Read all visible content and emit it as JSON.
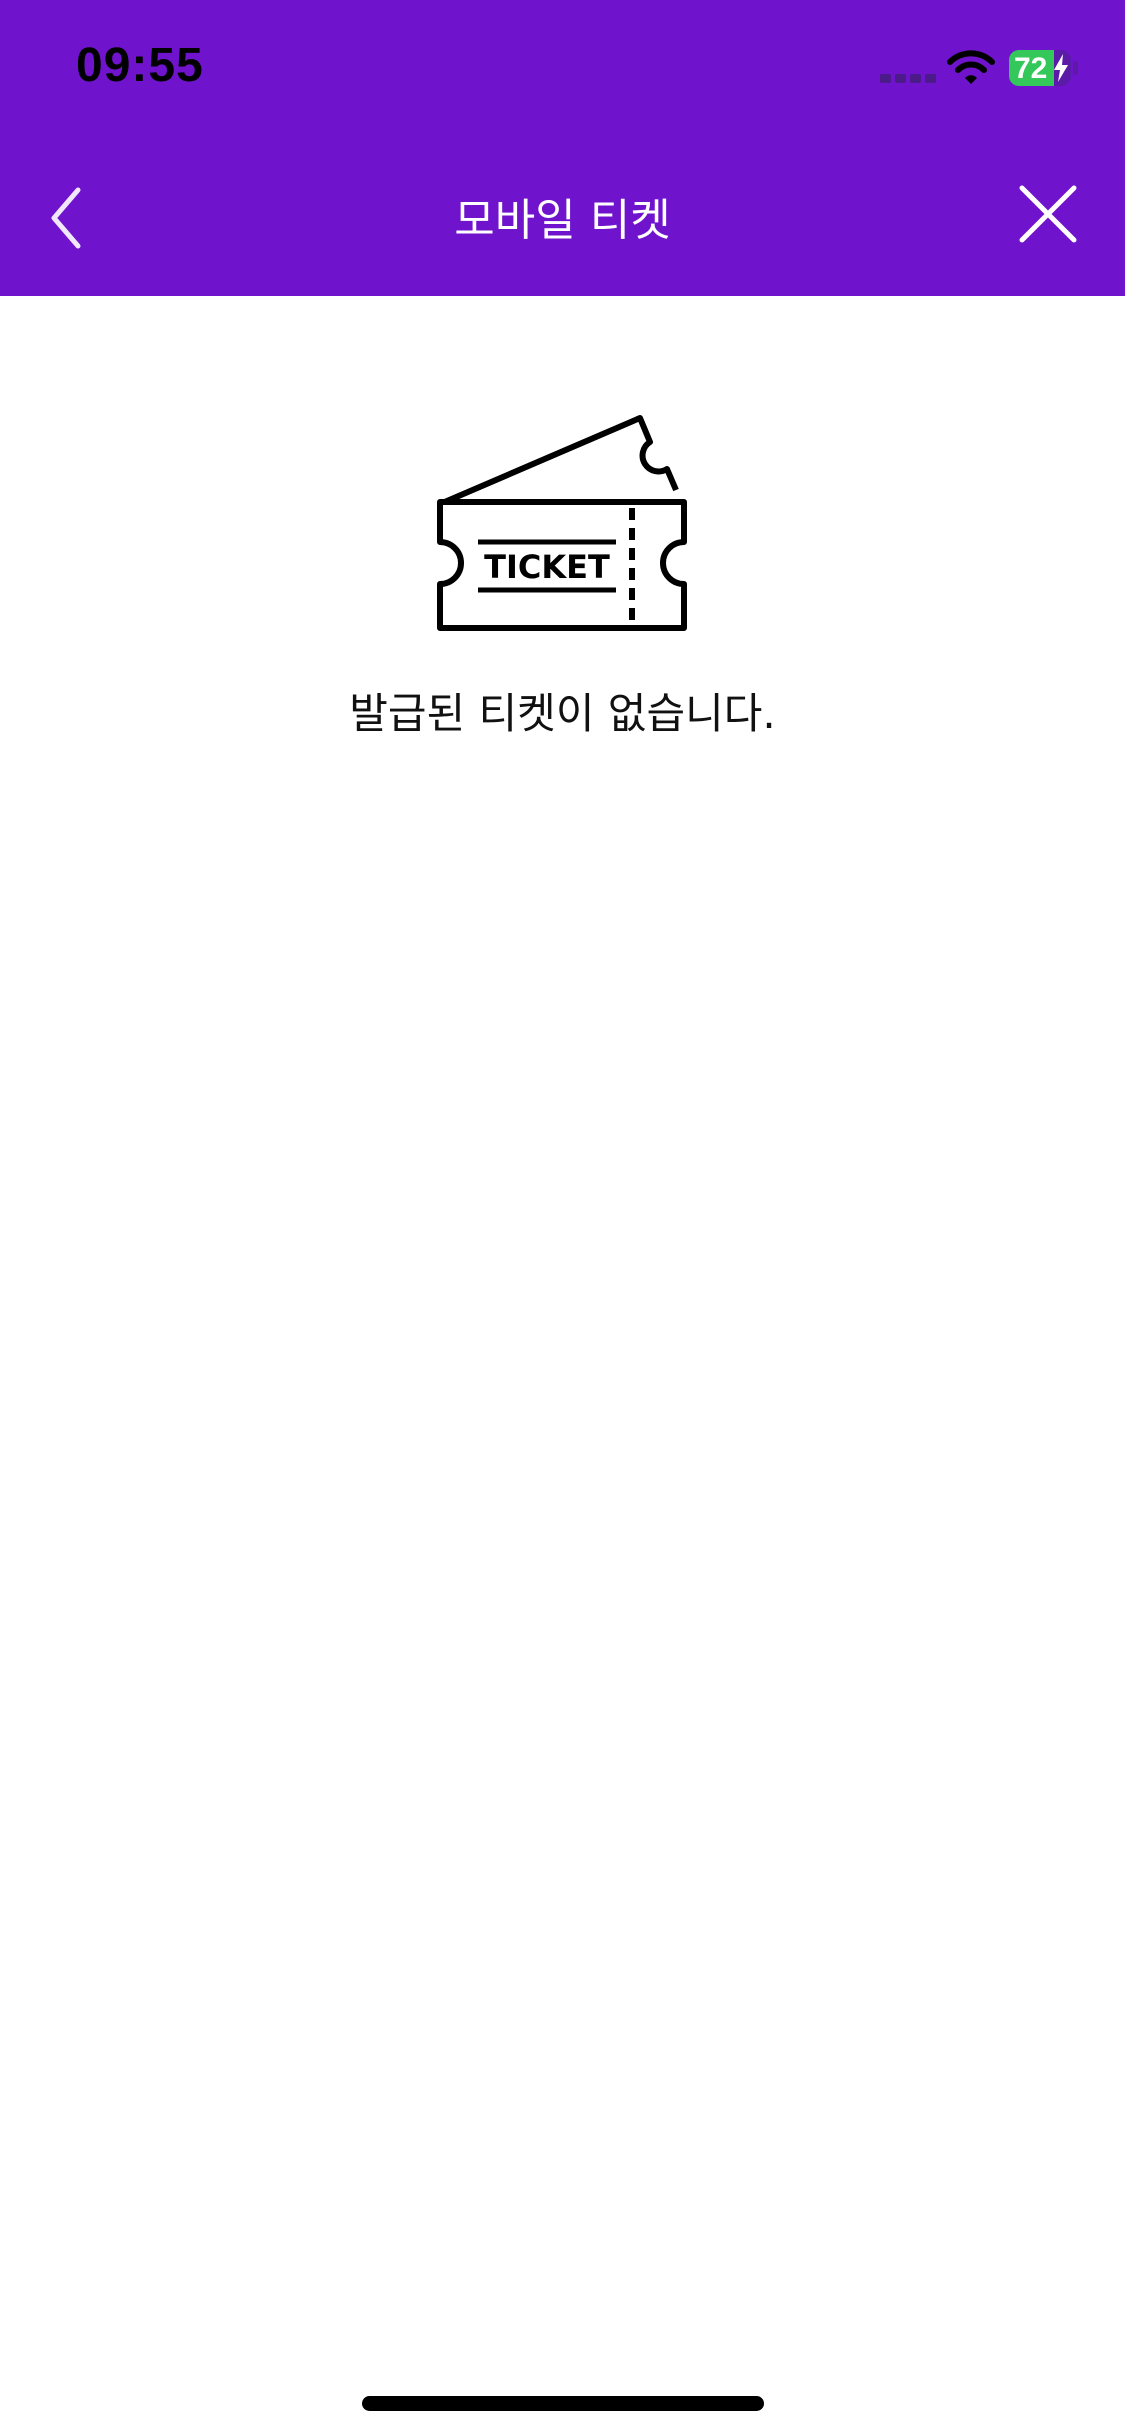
{
  "status_bar": {
    "time": "09:55",
    "battery_percent": "72",
    "battery_level": 0.72,
    "icons": [
      "signal-icon",
      "wifi-icon",
      "battery-icon",
      "charging-bolt-icon"
    ]
  },
  "nav": {
    "title": "모바일 티켓",
    "back_icon": "chevron-left-icon",
    "close_icon": "close-icon"
  },
  "empty_state": {
    "illustration_label": "TICKET",
    "illustration_icon": "ticket-icon",
    "message": "발급된 티켓이 없습니다."
  },
  "colors": {
    "header_bg": "#7013cc",
    "battery_fill": "#34c759",
    "text": "#111111"
  }
}
